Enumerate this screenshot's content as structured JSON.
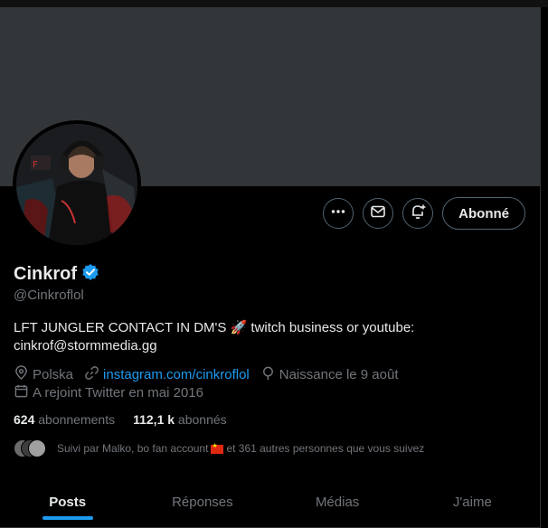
{
  "profile": {
    "name": "Cinkrof",
    "handle": "@Cinkroflol",
    "bio": "LFT JUNGLER CONTACT IN DM'S 🚀 twitch business or youtube: cinkrof@stormmedia.gg",
    "location": "Polska",
    "website": "instagram.com/cinkroflol",
    "birthday": "Naissance le 9 août",
    "joined": "A rejoint Twitter en mai 2016",
    "following_count": "624",
    "following_label": "abonnements",
    "followers_count": "112,1 k",
    "followers_label": "abonnés",
    "followed_by_prefix": "Suivi par Malko, bo fan account",
    "followed_by_suffix": "et 361 autres personnes que vous suivez"
  },
  "actions": {
    "follow_label": "Abonné"
  },
  "tabs": [
    {
      "label": "Posts",
      "active": true
    },
    {
      "label": "Réponses",
      "active": false
    },
    {
      "label": "Médias",
      "active": false
    },
    {
      "label": "J'aime",
      "active": false
    }
  ],
  "colors": {
    "accent": "#1d9bf0",
    "background": "#000000",
    "banner": "#333639",
    "secondary_text": "#71767b"
  },
  "icons": [
    "more-icon",
    "message-icon",
    "notification-add-icon",
    "verified-badge-icon",
    "location-icon",
    "link-icon",
    "birthday-icon",
    "calendar-icon"
  ]
}
